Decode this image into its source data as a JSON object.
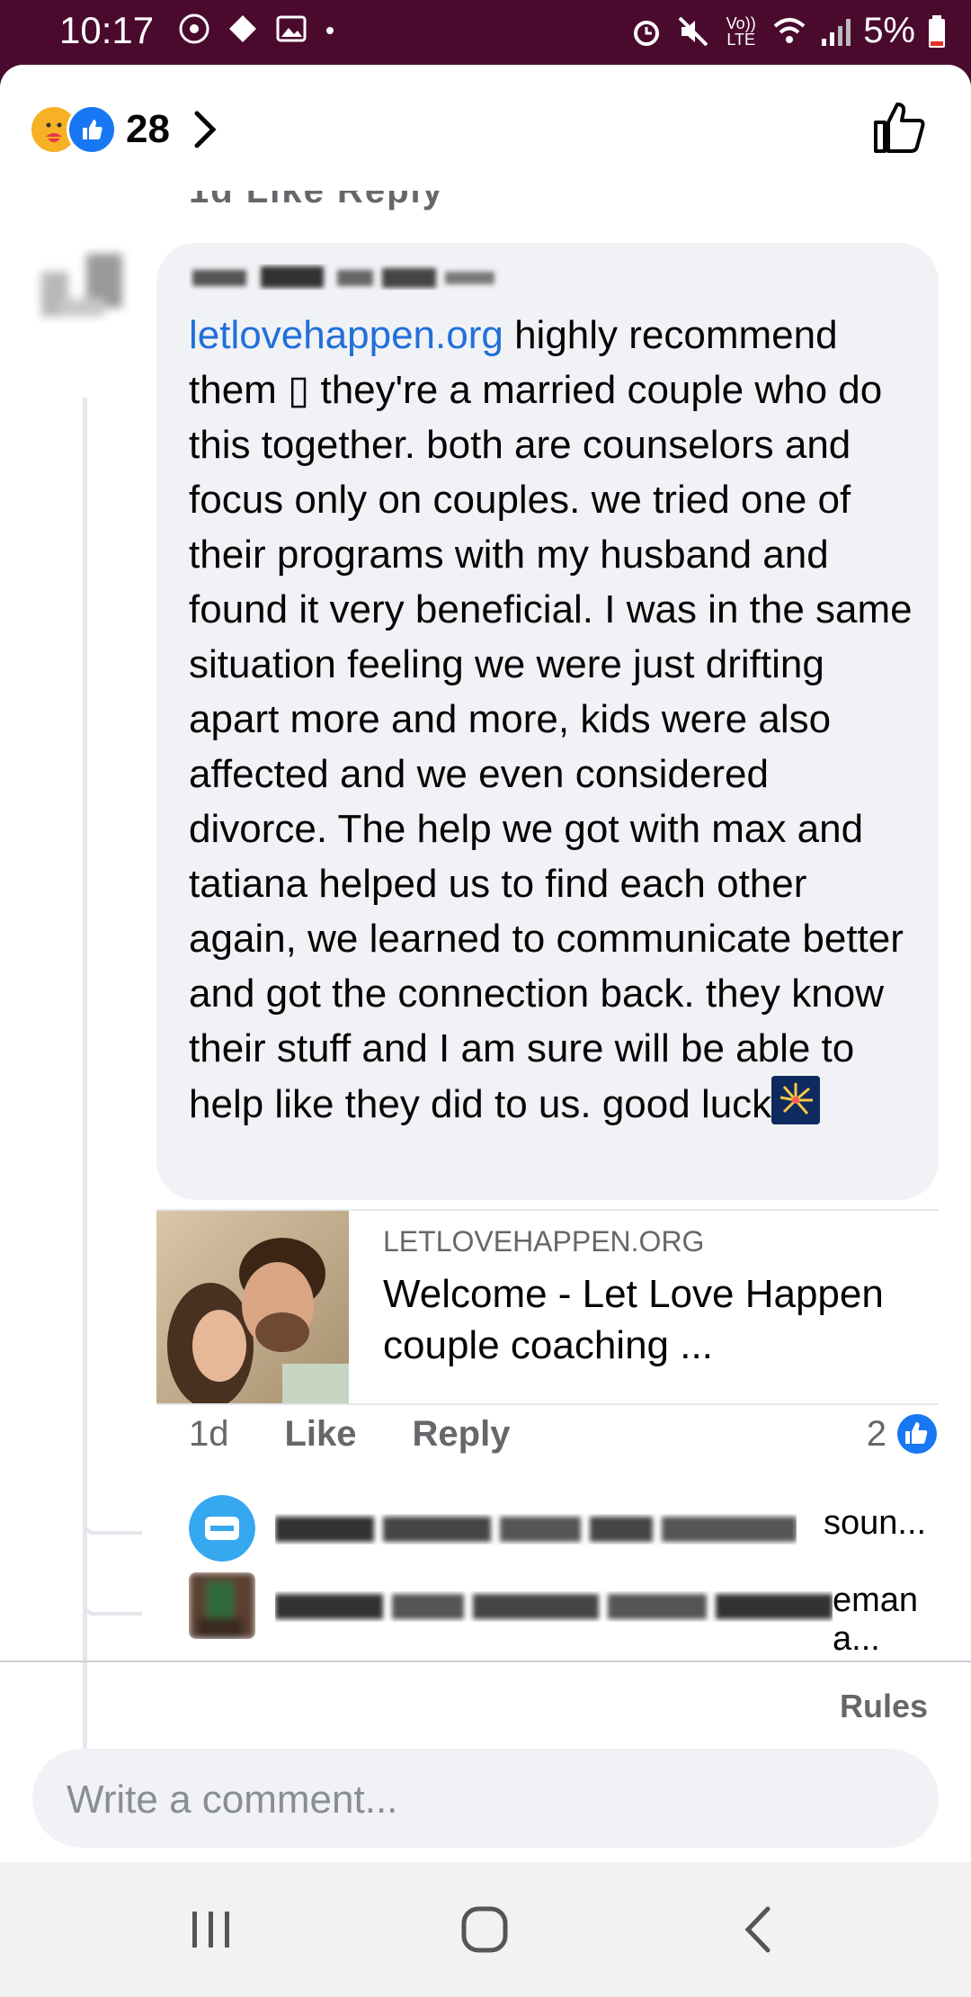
{
  "status_bar": {
    "time": "10:17",
    "network": "Vo)) LTE",
    "battery": "5%",
    "icons_left": [
      "messenger-icon",
      "diamond-icon",
      "gallery-icon",
      "dot-icon"
    ],
    "icons_right": [
      "alarm-icon",
      "mute-icon",
      "volte-icon",
      "wifi-icon",
      "signal-icon",
      "battery-icon"
    ]
  },
  "reactions_bar": {
    "count": "28",
    "reaction_types": [
      "care",
      "like"
    ]
  },
  "partial_actions": "1d   Like   Reply",
  "comment": {
    "link_text": "letlovehappen.org",
    "body": " highly recommend them ▯ they're a married couple who do this together. both are counselors and focus only on couples. we tried one of their programs with my husband and found it very beneficial. I was in the same situation feeling we were just drifting apart more and more, kids were also affected and we even considered divorce. The help we got with max and tatiana helped us to find each other again, we learned to communicate better and got the connection back. they know their stuff and I am sure will be able to help like they did to us. good luck",
    "emoji": "firework-icon"
  },
  "link_preview": {
    "domain": "LETLOVEHAPPEN.ORG",
    "title": "Welcome - Let Love Happen couple coaching ..."
  },
  "comment_actions": {
    "time": "1d",
    "like": "Like",
    "reply": "Reply",
    "reaction_count": "2"
  },
  "replies": [
    {
      "tail": "soun..."
    },
    {
      "tail": "eman a..."
    }
  ],
  "footer": {
    "rules": "Rules",
    "composer_placeholder": "Write a comment..."
  },
  "colors": {
    "status_bar": "#4a0a2e",
    "link": "#216fdb",
    "like_blue": "#1877f2",
    "bubble": "#f0f2f5",
    "secondary_text": "#65676b"
  }
}
